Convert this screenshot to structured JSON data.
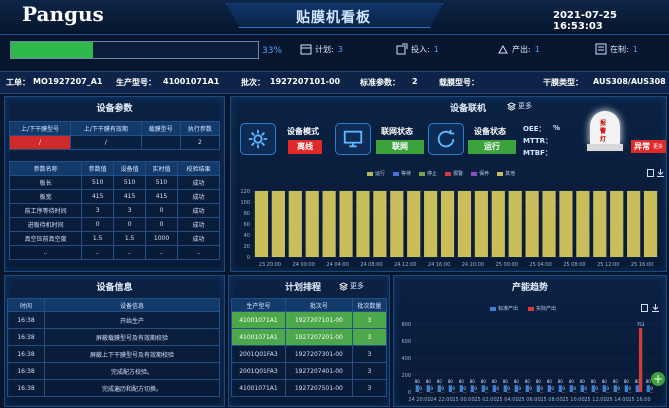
{
  "header": {
    "logo": "Pangus",
    "title": "贴膜机看板",
    "datetime": "2021-07-25 16:53:03"
  },
  "progress": {
    "percent": "33%",
    "fraction": 0.33
  },
  "stats": [
    {
      "label": "计划:",
      "value": "3"
    },
    {
      "label": "投入:",
      "value": "1"
    },
    {
      "label": "产出:",
      "value": "1"
    },
    {
      "label": "在制:",
      "value": "1"
    }
  ],
  "infobar": {
    "order_label": "工单：",
    "order": "MO1927207_A1",
    "model_label": "生产型号：",
    "model": "41001071A1",
    "batch_label": "批次：",
    "batch": "1927207101-00",
    "std_label": "标准参数：",
    "std": "2",
    "film_label": "载膜型号：",
    "film": "",
    "dry_label": "干膜类型：",
    "dry": "AUS308/AUS308"
  },
  "device_params": {
    "title": "设备参数",
    "top_headers": [
      "上/下干膜型号",
      "上/下干膜有效期",
      "载膜型号",
      "执行参数"
    ],
    "top_values": [
      "/",
      "/",
      "",
      "2"
    ],
    "headers": [
      "参数名称",
      "参数值",
      "设备值",
      "实时值",
      "校验结果"
    ],
    "rows": [
      [
        "板长",
        "510",
        "510",
        "510",
        "成功"
      ],
      [
        "板宽",
        "415",
        "415",
        "415",
        "成功"
      ],
      [
        "前工序等待时间",
        "3",
        "3",
        "0",
        "成功"
      ],
      [
        "进板待机时间",
        "0",
        "0",
        "0",
        "成功"
      ],
      [
        "真空压前真空度",
        "1.5",
        "1.5",
        "1000",
        "成功"
      ],
      [
        "..",
        "..",
        "..",
        "..",
        ".."
      ]
    ]
  },
  "device_link": {
    "title": "设备联机",
    "more": "更多",
    "mode_label": "设备模式",
    "mode_value": "离线",
    "net_label": "联网状态",
    "net_value": "联网",
    "state_label": "设备状态",
    "state_value": "运行",
    "oee_label": "OEE：",
    "oee_unit": "%",
    "mttr_label": "MTTR：",
    "mtbf_label": "MTBF：",
    "alarm_label": "报警灯",
    "alarm_status": "异常",
    "alarm_more": "更多"
  },
  "status_chart_data": {
    "type": "bar",
    "legend": [
      "运行",
      "等待",
      "停止",
      "报警",
      "保养",
      "其他"
    ],
    "colors": [
      "#b7b85a",
      "#4a6fd6",
      "#7aa24e",
      "#d23c3c",
      "#8b4cc9",
      "#c9bd5c"
    ],
    "yticks": [
      "120",
      "100",
      "80",
      "60",
      "40",
      "20",
      "0"
    ],
    "ymax": 120,
    "xticks": [
      "23 20:00",
      "24 00:00",
      "24 04:00",
      "24 08:00",
      "24 12:00",
      "24 16:00",
      "24 20:00",
      "25 00:00",
      "25 04:00",
      "25 08:00",
      "25 12:00",
      "25 16:00"
    ],
    "bar_count": 24,
    "bar_value": 120
  },
  "device_info": {
    "title": "设备信息",
    "headers": [
      "时间",
      "设备信息"
    ],
    "rows": [
      [
        "16:38",
        "开始生产"
      ],
      [
        "16:38",
        "屏蔽载膜型号及有效期校验"
      ],
      [
        "16:38",
        "屏蔽上下干膜型号及有效期校验"
      ],
      [
        "16:38",
        "完成配方校验。"
      ],
      [
        "16:38",
        "完成遍历和配方切换。"
      ]
    ]
  },
  "plan": {
    "title": "计划排程",
    "more": "更多",
    "headers": [
      "生产型号",
      "批次号",
      "批次数量"
    ],
    "rows": [
      [
        "41001071A1",
        "1927207101-00",
        "3"
      ],
      [
        "41001071A1",
        "1927207201-00",
        "3"
      ],
      [
        "2001Q01FA3",
        "1927207301-00",
        "3"
      ],
      [
        "2001Q01FA3",
        "1927207401-00",
        "3"
      ],
      [
        "41001071A1",
        "1927207501-00",
        "3"
      ]
    ]
  },
  "trend": {
    "title": "产能趋势",
    "legend": [
      "标准产出",
      "实际产出"
    ],
    "colors": [
      "#3d7fd0",
      "#d83b3b"
    ]
  },
  "chart_data": {
    "type": "bar",
    "title": "产能趋势",
    "categories": [
      "24 20:00",
      "",
      "",
      "",
      "",
      "",
      "",
      "",
      "",
      "",
      "",
      "",
      "",
      "",
      "",
      "",
      "",
      "",
      "",
      "",
      "",
      "25 16:00"
    ],
    "xticks": [
      "24 20:00",
      "24 22:00",
      "25 00:00",
      "25 02:00",
      "25 04:00",
      "25 06:00",
      "25 08:00",
      "25 10:00",
      "25 12:00",
      "25 14:00",
      "25 16:00"
    ],
    "series": [
      {
        "name": "标准产出",
        "values": [
          80,
          80,
          80,
          80,
          80,
          80,
          80,
          80,
          80,
          80,
          80,
          80,
          80,
          80,
          80,
          80,
          80,
          80,
          80,
          80,
          80,
          80
        ]
      },
      {
        "name": "实际产出",
        "values": [
          0,
          0,
          0,
          0,
          0,
          0,
          0,
          0,
          0,
          0,
          0,
          0,
          0,
          0,
          0,
          0,
          0,
          0,
          0,
          0,
          753,
          0
        ]
      }
    ],
    "yticks": [
      "800",
      "600",
      "400",
      "200",
      "0"
    ],
    "ylim": [
      0,
      800
    ]
  }
}
